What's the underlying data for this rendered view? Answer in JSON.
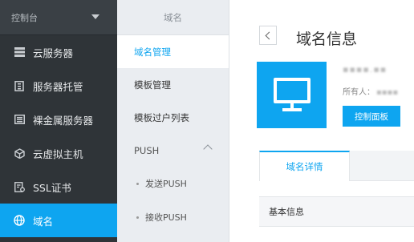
{
  "sidebar": {
    "console_label": "控制台",
    "items": [
      {
        "label": "云服务器",
        "icon": "server-list-icon"
      },
      {
        "label": "服务器托管",
        "icon": "server-rack-icon"
      },
      {
        "label": "裸金属服务器",
        "icon": "bare-metal-icon"
      },
      {
        "label": "云虚拟主机",
        "icon": "cube-icon"
      },
      {
        "label": "SSL证书",
        "icon": "certificate-icon"
      },
      {
        "label": "域名",
        "icon": "globe-icon",
        "active": true
      }
    ]
  },
  "submenu": {
    "title": "域名",
    "items": [
      {
        "label": "域名管理",
        "active": true
      },
      {
        "label": "模板管理"
      },
      {
        "label": "模板过户列表"
      }
    ],
    "group": {
      "label": "PUSH",
      "children": [
        "发送PUSH",
        "接收PUSH"
      ]
    }
  },
  "main": {
    "back_icon": "chevron-left-icon",
    "title": "域名信息",
    "domain_name": "▪▪▪▪.▪▪",
    "owner_label": "所有人：",
    "owner_value": "▪▪▪▪",
    "panel_button": "控制面板",
    "tab_label": "域名详情",
    "section_header": "基本信息"
  },
  "colors": {
    "accent": "#0ea5f0",
    "sidebar_bg": "#2f3438",
    "submenu_bg": "#eaedf1"
  }
}
